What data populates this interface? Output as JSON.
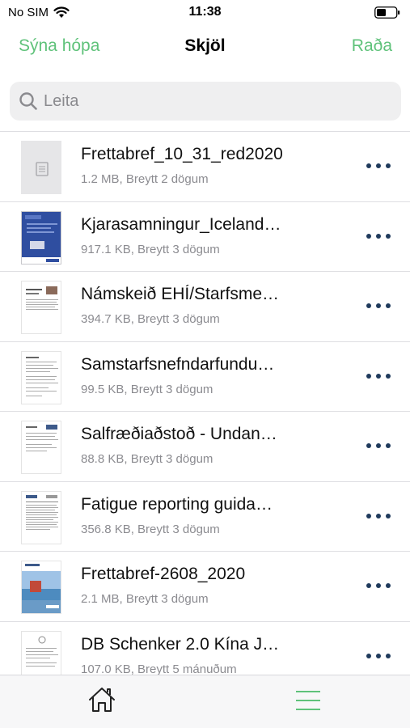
{
  "status_bar": {
    "carrier": "No SIM",
    "time": "11:38",
    "icons": [
      "wifi-icon",
      "battery-icon"
    ]
  },
  "nav": {
    "left_label": "Sýna hópa",
    "title": "Skjöl",
    "right_label": "Raða"
  },
  "search": {
    "placeholder": "Leita",
    "value": ""
  },
  "documents": [
    {
      "name": "Frettabref_10_31_red2020",
      "meta": "1.2 MB, Breytt 2 dögum",
      "thumbnail": "generic-document-icon"
    },
    {
      "name": "Kjarasamningur_Iceland…",
      "meta": "917.1 KB, Breytt 3 dögum",
      "thumbnail": "blue-cover-thumbnail"
    },
    {
      "name": "Námskeið EHÍ/Starfsme…",
      "meta": "394.7 KB, Breytt 3 dögum",
      "thumbnail": "document-thumbnail"
    },
    {
      "name": "Samstarfsnefndarfundu…",
      "meta": "99.5 KB, Breytt 3 dögum",
      "thumbnail": "document-thumbnail"
    },
    {
      "name": "Salfræðiaðstoð - Undan…",
      "meta": "88.8 KB, Breytt 3 dögum",
      "thumbnail": "document-thumbnail"
    },
    {
      "name": "Fatigue reporting guida…",
      "meta": "356.8 KB, Breytt 3 dögum",
      "thumbnail": "document-thumbnail"
    },
    {
      "name": "Frettabref-2608_2020",
      "meta": "2.1 MB, Breytt 3 dögum",
      "thumbnail": "photo-thumbnail"
    },
    {
      "name": "DB Schenker 2.0 Kína J…",
      "meta": "107.0 KB, Breytt 5 mánuðum",
      "thumbnail": "document-thumbnail"
    }
  ],
  "tabbar": {
    "items": [
      "home-icon",
      "list-icon"
    ],
    "active": "list-icon"
  },
  "colors": {
    "accent": "#5fc27a",
    "more_dots": "#1f3a5c",
    "meta_text": "#8b8b90"
  }
}
